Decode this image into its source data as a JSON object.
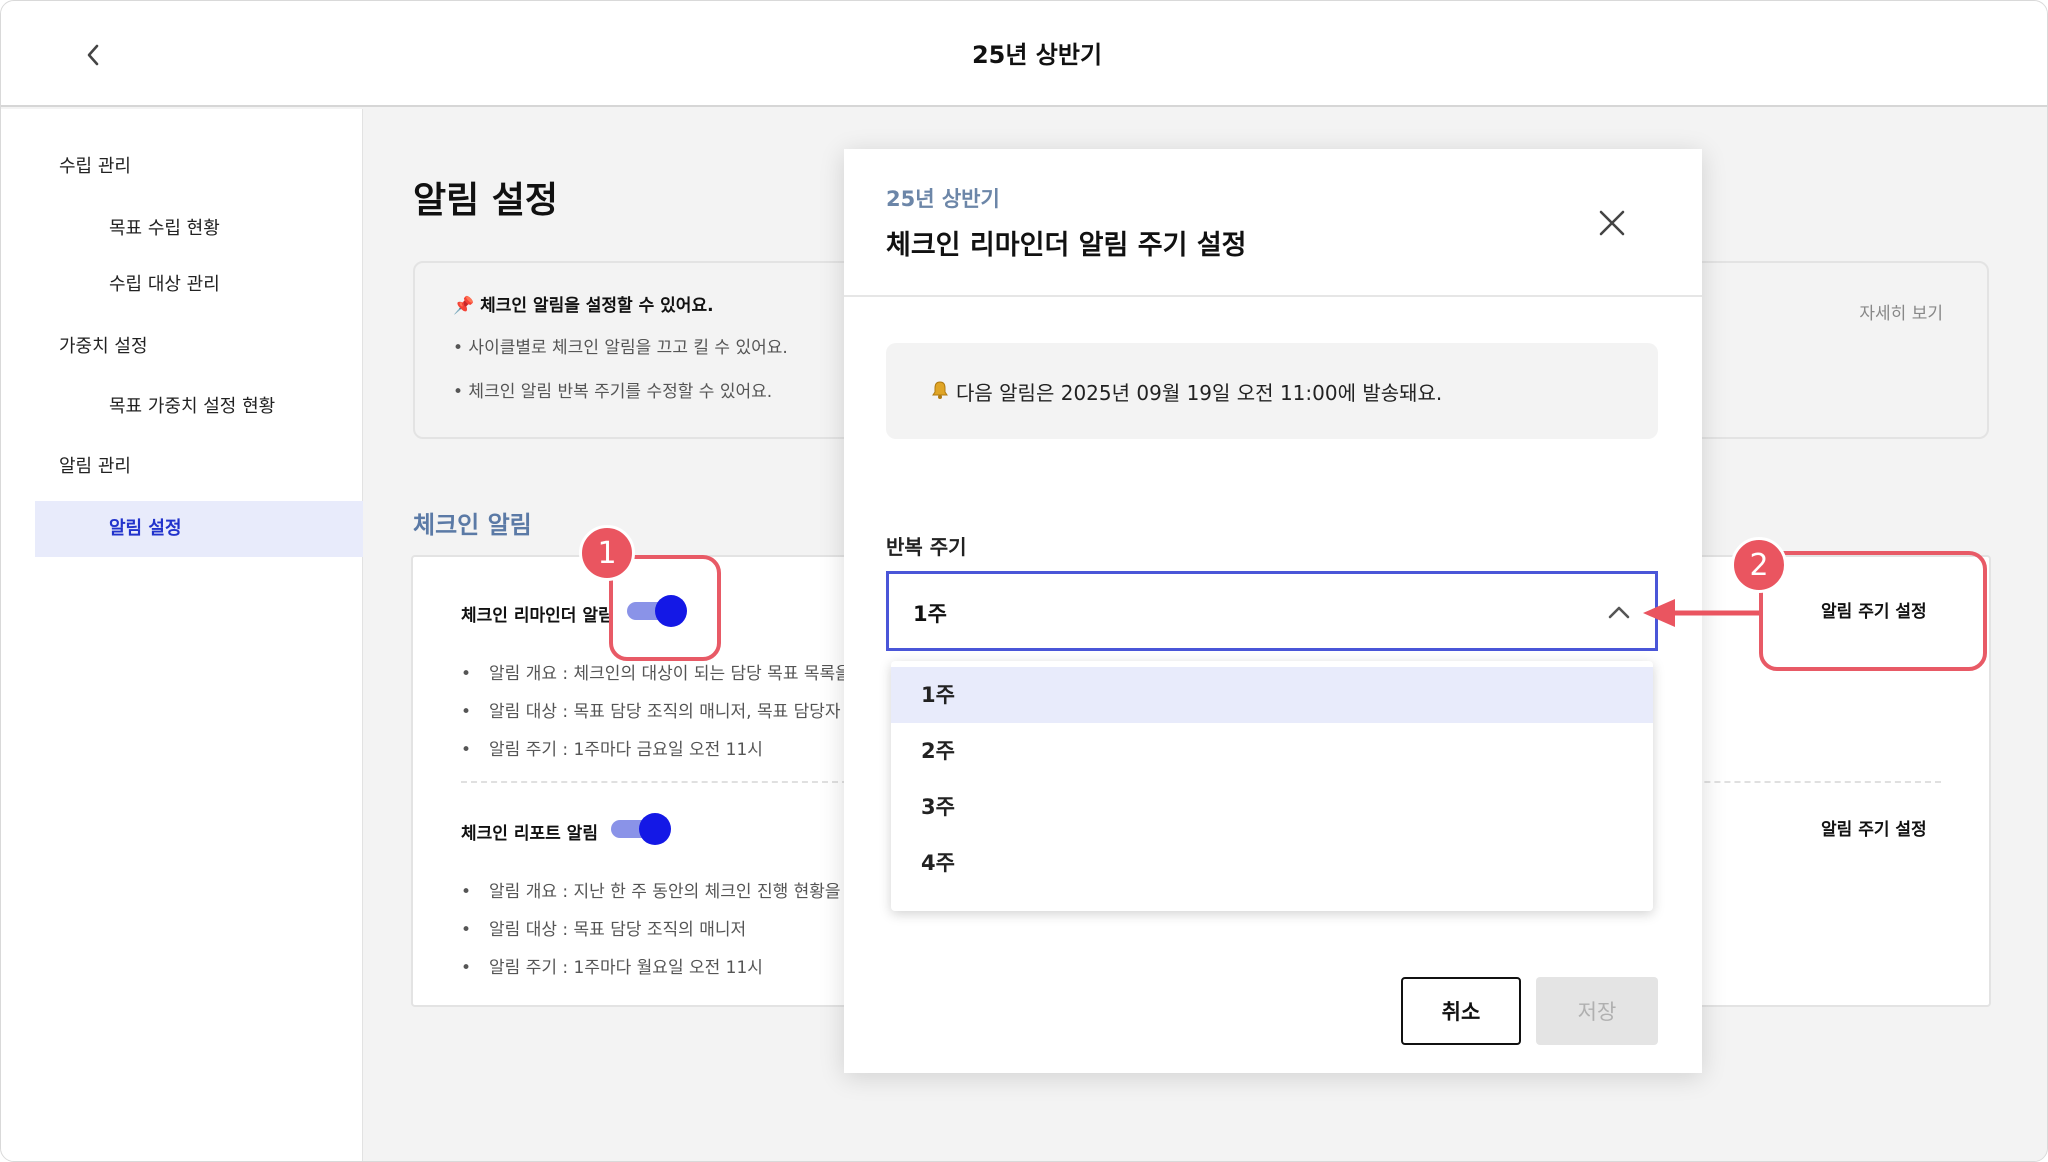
{
  "header": {
    "title": "25년 상반기"
  },
  "sidebar": {
    "items": [
      {
        "label": "수립 관리"
      },
      {
        "label": "목표 수립 현황"
      },
      {
        "label": "수립 대상 관리"
      },
      {
        "label": "가중치 설정"
      },
      {
        "label": "목표 가중치 설정 현황"
      },
      {
        "label": "알림 관리"
      },
      {
        "label": "알림 설정"
      }
    ],
    "active_item": "알림 설정"
  },
  "main": {
    "page_title": "알림 설정",
    "info": {
      "heading": "📌 체크인 알림을 설정할 수 있어요.",
      "bullets": [
        "• 사이클별로 체크인 알림을 끄고 킬 수 있어요.",
        "• 체크인 알림 반복 주기를 수정할 수 있어요."
      ],
      "more_link": "자세히 보기"
    },
    "section_title": "체크인 알림",
    "notifications": [
      {
        "name": "체크인 리마인더 알림",
        "enabled": true,
        "details": [
          "알림 개요 : 체크인의 대상이 되는 담당 목표 목록을",
          "알림 대상 : 목표 담당 조직의 매니저, 목표 담당자",
          "알림 주기 : 1주마다 금요일 오전 11시"
        ],
        "setting_link": "알림 주기 설정"
      },
      {
        "name": "체크인 리포트 알림",
        "enabled": true,
        "details": [
          "알림 개요 : 지난 한 주 동안의 체크인 진행 현황을",
          "알림 대상 : 목표 담당 조직의 매니저",
          "알림 주기 : 1주마다 월요일 오전 11시"
        ],
        "setting_link": "알림 주기 설정"
      }
    ]
  },
  "modal": {
    "subtitle": "25년 상반기",
    "title": "체크인 리마인더 알림 주기 설정",
    "notice": "다음 알림은 2025년 09월 19일 오전 11:00에 발송돼요.",
    "field_label": "반복 주기",
    "selected_value": "1주",
    "options": [
      "1주",
      "2주",
      "3주",
      "4주"
    ],
    "cancel_label": "취소",
    "save_label": "저장"
  },
  "annotations": {
    "badge_1": "1",
    "badge_2": "2"
  },
  "colors": {
    "accent": "#1418e6",
    "highlight": "#e85a66",
    "active_bg": "#e8ebfb"
  }
}
